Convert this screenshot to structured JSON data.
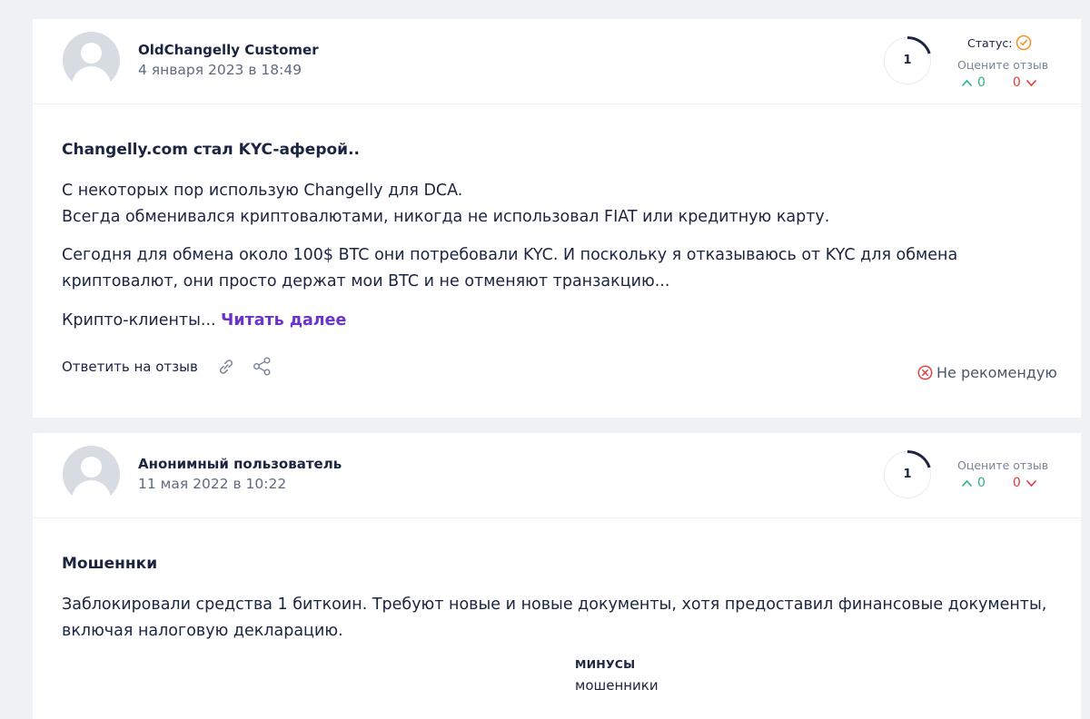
{
  "reviews": [
    {
      "author": "OldChangelly Customer",
      "date": "4 января 2023 в 18:49",
      "rating": "1",
      "status_label": "Статус:",
      "rate_label": "Оцените отзыв",
      "votes_up": "0",
      "votes_down": "0",
      "title": "Changelly.com стал KYC-аферой..",
      "paragraphs": [
        "С некоторых пор использую Changelly для DCA.",
        "Всегда обменивался криптовалютами, никогда не использовал FIAT или кредитную карту.",
        "Сегодня для обмена около 100$ BTC они потребовали KYC. И поскольку я отказываюсь от KYC для обмена",
        "криптовалют, они просто держат мои BTC и не отменяют транзакцию...",
        "Крипто-клиенты... "
      ],
      "read_more": "Читать далее",
      "reply_label": "Ответить на отзыв",
      "recommendation": "Не рекомендую"
    },
    {
      "author": "Анонимный пользователь",
      "date": "11 мая 2022 в 10:22",
      "rating": "1",
      "rate_label": "Оцените отзыв",
      "votes_up": "0",
      "votes_down": "0",
      "title": "Мошеннки",
      "paragraphs": [
        "Заблокировали средства 1 биткоин. Требуют новые и новые документы, хотя предоставил финансовые документы,",
        "включая налоговую декларацию."
      ],
      "cons_title": "МИНУСЫ",
      "cons_text": "мошенники"
    }
  ],
  "colors": {
    "background": "#eef2f5",
    "card": "#ffffff",
    "text": "#1b2440",
    "muted": "#5f6b7e",
    "link": "#6b34c9",
    "vote_up": "#2bb37a",
    "vote_down": "#e23a3a",
    "status_icon": "#f2962b"
  },
  "icons": {
    "avatar": "user-silhouette-icon",
    "status": "check-circle-icon",
    "up": "chevron-up-icon",
    "down": "chevron-down-icon",
    "link": "link-icon",
    "share": "share-icon",
    "not_recommend": "x-circle-icon"
  }
}
